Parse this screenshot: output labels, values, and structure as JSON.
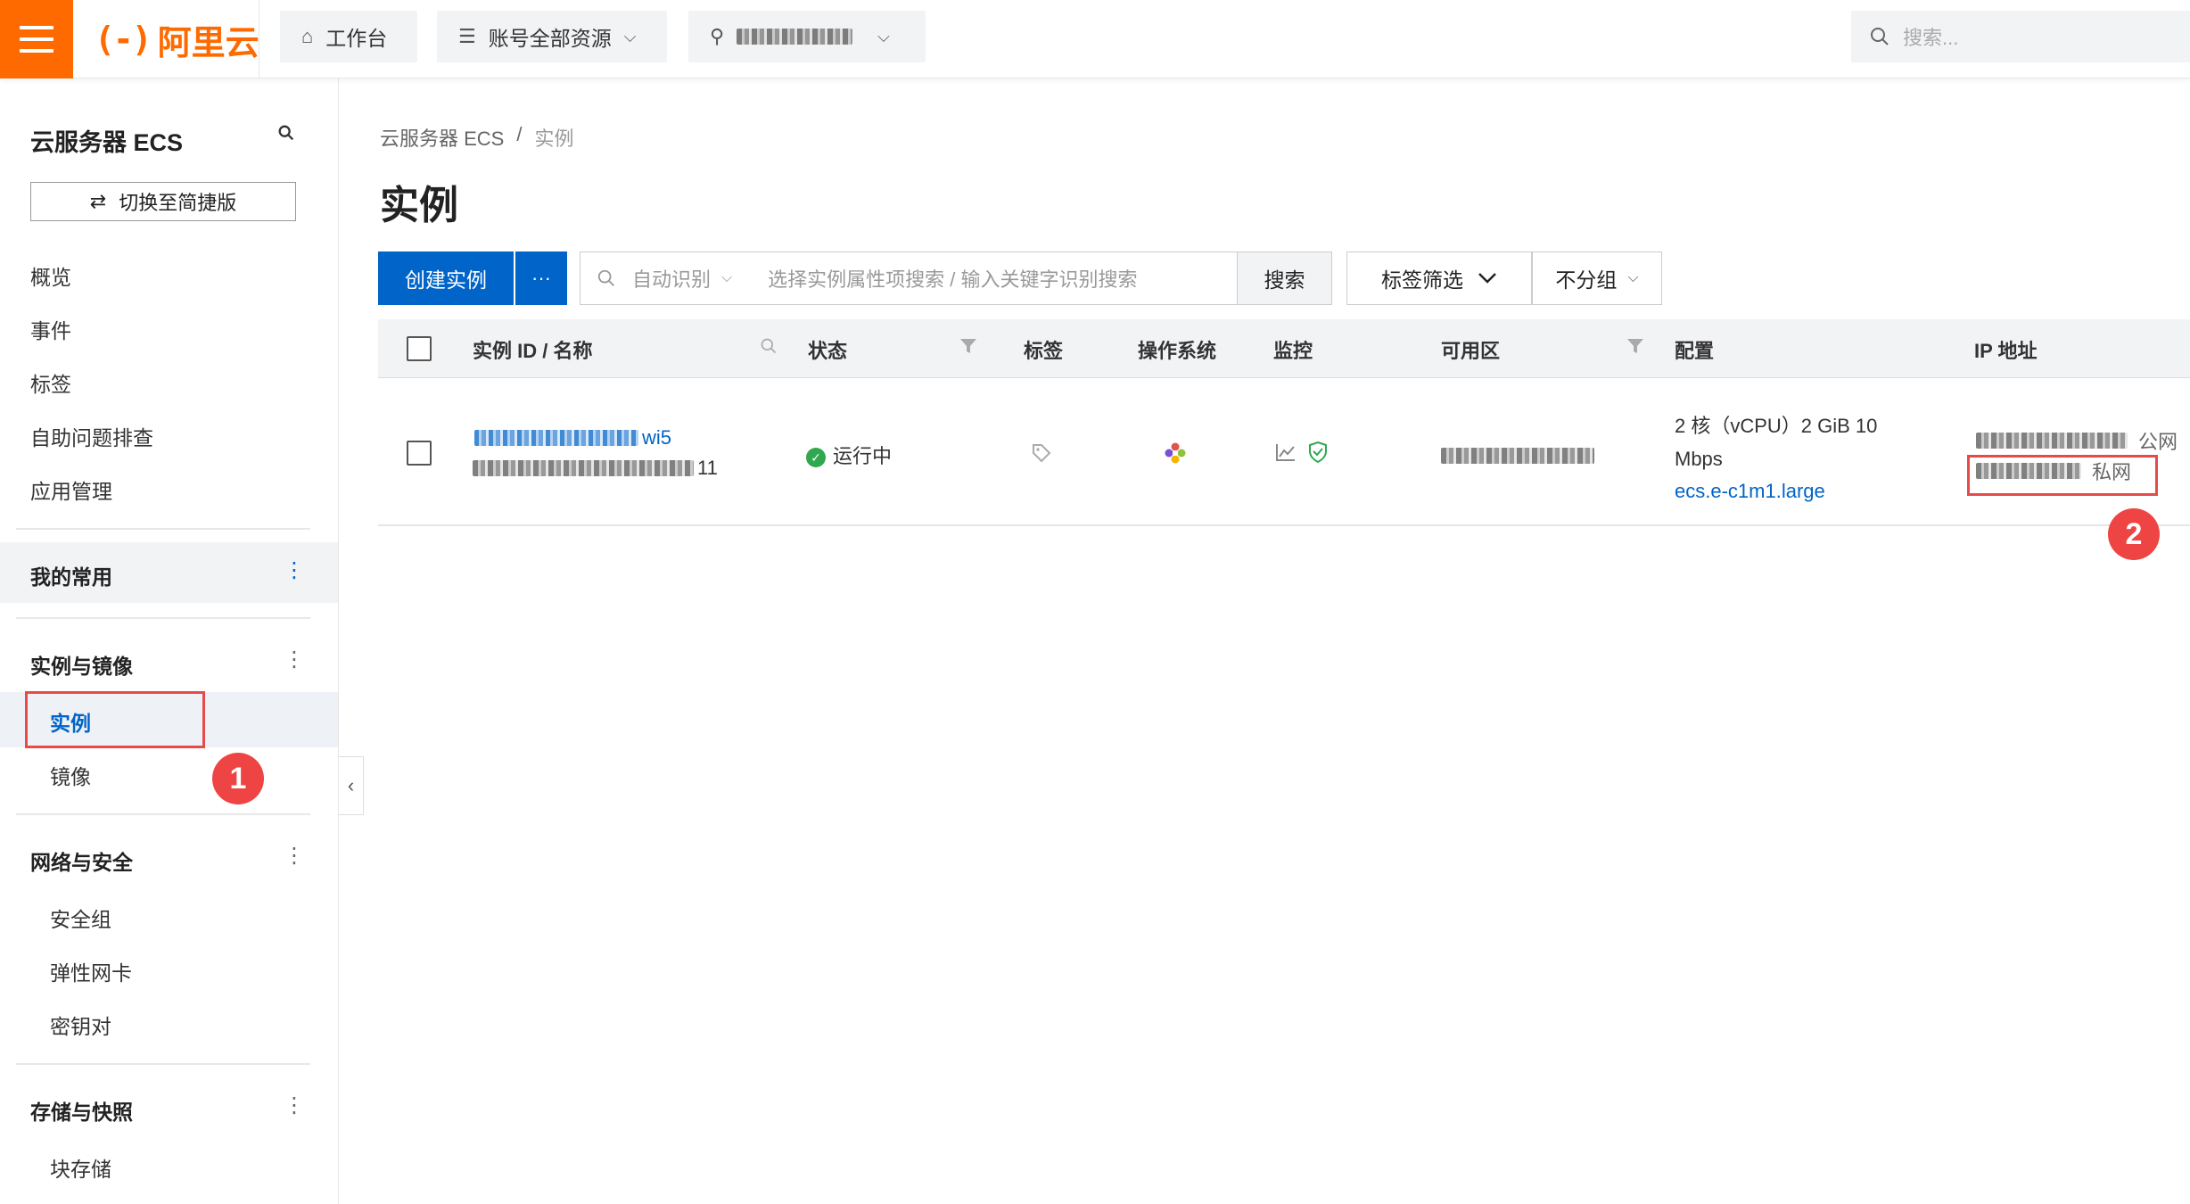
{
  "topbar": {
    "logo_mark": "(-)",
    "logo_text": "阿里云",
    "workbench_label": "工作台",
    "resources_label": "账号全部资源",
    "region_label": "",
    "search_placeholder": "搜索..."
  },
  "sidebar": {
    "title": "云服务器 ECS",
    "switch_label": "切换至简捷版",
    "items": [
      "概览",
      "事件",
      "标签",
      "自助问题排查",
      "应用管理"
    ],
    "favorites_label": "我的常用",
    "groups": [
      {
        "title": "实例与镜像",
        "items": [
          "实例",
          "镜像"
        ]
      },
      {
        "title": "网络与安全",
        "items": [
          "安全组",
          "弹性网卡",
          "密钥对"
        ]
      },
      {
        "title": "存储与快照",
        "items": [
          "块存储"
        ]
      }
    ],
    "active_item": "实例"
  },
  "annotations": {
    "badge1": "1",
    "badge2": "2"
  },
  "main": {
    "breadcrumb": {
      "parent": "云服务器 ECS",
      "separator": "/",
      "current": "实例"
    },
    "title": "实例",
    "toolbar": {
      "create_label": "创建实例",
      "more_label": "···",
      "search_mode": "自动识别",
      "search_placeholder": "选择实例属性项搜索 / 输入关键字识别搜索",
      "search_button": "搜索",
      "tag_filter": "标签筛选",
      "group_label": "不分组"
    },
    "table": {
      "headers": [
        "实例 ID / 名称",
        "状态",
        "标签",
        "操作系统",
        "监控",
        "可用区",
        "配置",
        "IP 地址"
      ],
      "rows": [
        {
          "id_suffix": "wi5",
          "name_suffix": "11",
          "status": "运行中",
          "config_line1": "2 核（vCPU）2 GiB 10",
          "config_line2": "Mbps",
          "instance_type": "ecs.e-c1m1.large",
          "public_label": "公网",
          "private_label": "私网"
        }
      ]
    }
  },
  "colors": {
    "accent": "#ff6a00",
    "primary": "#0064c8",
    "highlight": "#e84a4a",
    "running": "#2fa84f"
  }
}
